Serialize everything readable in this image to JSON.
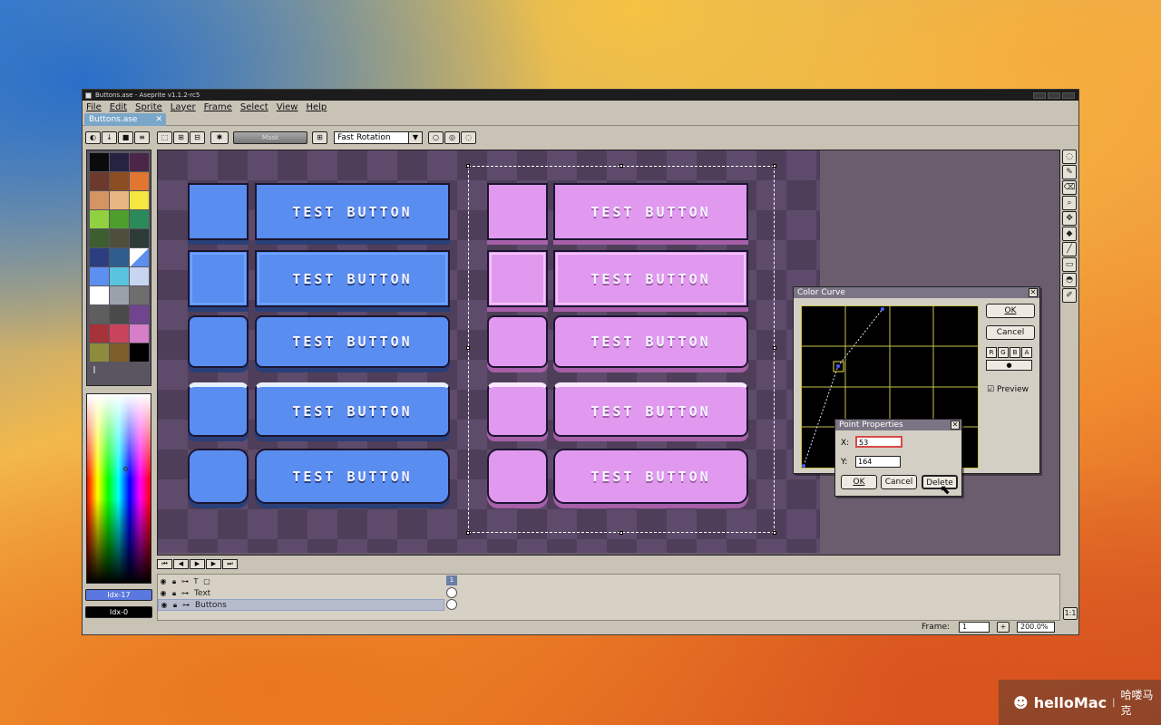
{
  "window": {
    "title": "Buttons.ase - Aseprite v1.1.2-rc5",
    "menu": [
      "File",
      "Edit",
      "Sprite",
      "Layer",
      "Frame",
      "Select",
      "View",
      "Help"
    ],
    "doc_tab": "Buttons.ase"
  },
  "toolbar": {
    "mask_label": "Mask",
    "rotation_select": "Fast Rotation"
  },
  "palette": {
    "colors": [
      "#0b0b0e",
      "#262241",
      "#4b2648",
      "#6b3a2c",
      "#8c4d23",
      "#e07630",
      "#d49463",
      "#e8b681",
      "#f5e641",
      "#91d13f",
      "#4d9e2c",
      "#2c8a5a",
      "#3d5e2f",
      "#4e4e3c",
      "#2d3c37",
      "#2a3e80",
      "#2f5e8e",
      "#5d8ff0",
      "#5d8ff0",
      "#59c4dd",
      "#c8d5f1",
      "#ffffff",
      "#9aa1ab",
      "#6e6e6e",
      "#5e5e5e",
      "#4a4a4a",
      "#70448f",
      "#a6323a",
      "#c8445b",
      "#d67ec7",
      "#8c8c3c",
      "#7d5f2a",
      "#000000"
    ],
    "fg_index": "Idx-17",
    "bg_index": "Idx-0"
  },
  "sprite": {
    "button_label": "TEST BUTTON"
  },
  "layers": [
    {
      "name": "",
      "icons": [
        "eye",
        "lock",
        "link",
        "text",
        "frame"
      ]
    },
    {
      "name": "Text"
    },
    {
      "name": "Buttons"
    }
  ],
  "timeline": {
    "frame_number": "1"
  },
  "status": {
    "frame_label": "Frame:",
    "frame_value": "1",
    "zoom": "200.0%"
  },
  "color_curve": {
    "title": "Color Curve",
    "ok": "OK",
    "cancel": "Cancel",
    "channels": [
      "R",
      "G",
      "B",
      "A"
    ],
    "preview_label": "Preview",
    "preview_checked": true
  },
  "point_properties": {
    "title": "Point Properties",
    "x_label": "X:",
    "x_value": "53",
    "y_label": "Y:",
    "y_value": "164",
    "ok": "OK",
    "cancel": "Cancel",
    "delete": "Delete"
  },
  "watermark": {
    "brand": "helloMac",
    "separator": "|",
    "cn": "哈喽马克"
  },
  "colors": {
    "blue_button": "#5a8df0",
    "pink_button": "#e199f0",
    "canvas_bg": "#4f3e59"
  }
}
